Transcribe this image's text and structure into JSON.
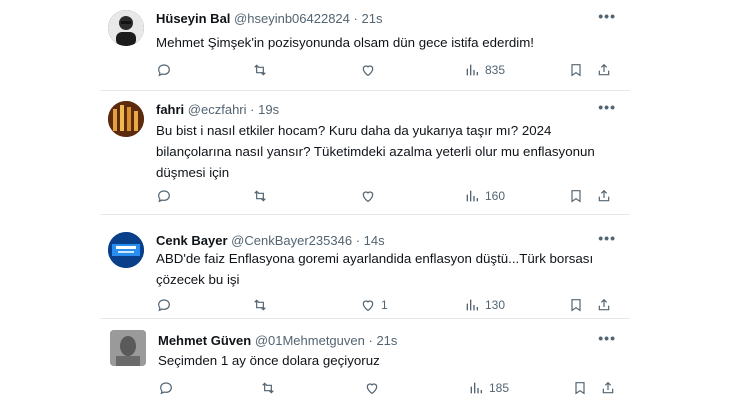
{
  "tweets": [
    {
      "name": "Hüseyin Bal",
      "handle": "@hseyinb06422824",
      "dot": "·",
      "time": "21s",
      "text": "Mehmet Şimşek'in pozisyonunda olsam dün gece istifa ederdim!",
      "likes": "",
      "views": "835",
      "avatar_color": "#3a3a3a"
    },
    {
      "name": "fahri",
      "handle": "@eczfahri",
      "dot": "·",
      "time": "19s",
      "text": "Bu bist i nasıl etkiler hocam? Kuru daha da yukarıya taşır mı? 2024 bilançolarına nasıl yansır? Tüketimdeki azalma yeterli olur mu enflasyonun düşmesi için",
      "likes": "",
      "views": "160",
      "avatar_color": "#7a3b12"
    },
    {
      "name": "Cenk Bayer",
      "handle": "@CenkBayer235346",
      "dot": "·",
      "time": "14s",
      "text": "ABD'de faiz  Enflasyona goremi ayarlandida enflasyon düştü...Türk borsası çözecek bu işi",
      "likes": "1",
      "views": "130",
      "avatar_color": "#0b5db8"
    },
    {
      "name": "Mehmet Güven",
      "handle": "@01Mehmetguven",
      "dot": "·",
      "time": "21s",
      "text": "Seçimden 1 ay önce dolara geçiyoruz",
      "likes": "",
      "views": "185",
      "avatar_color": "#8a8a8a"
    }
  ],
  "icons": [
    "reply-icon",
    "retweet-icon",
    "like-icon",
    "views-icon",
    "bookmark-icon",
    "share-icon",
    "more-icon"
  ],
  "colors": {
    "text": "#0f1419",
    "secondary": "#536471",
    "divider": "#e6e9ec"
  }
}
